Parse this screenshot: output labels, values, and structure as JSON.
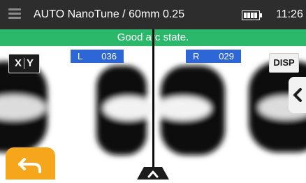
{
  "header": {
    "title": "AUTO NanoTune / 60mm 0.25",
    "time": "11:26",
    "icons": {
      "menu": "menu-icon",
      "battery": "battery-icon"
    }
  },
  "status": {
    "message": "Good arc state.",
    "color": "#2bb86b"
  },
  "controls": {
    "xy_x": "X",
    "xy_y": "Y",
    "disp_label": "DISP"
  },
  "readouts": {
    "left": {
      "side": "L",
      "value": "036"
    },
    "right": {
      "side": "R",
      "value": "029"
    }
  },
  "icons": {
    "back": "back-arrow-icon",
    "side_tab": "chevron-left-icon",
    "bottom_tab": "chevron-up-icon"
  },
  "colors": {
    "accent_blue": "#2d66d6",
    "back_button": "#f6a61b",
    "status_green": "#2bb86b"
  }
}
